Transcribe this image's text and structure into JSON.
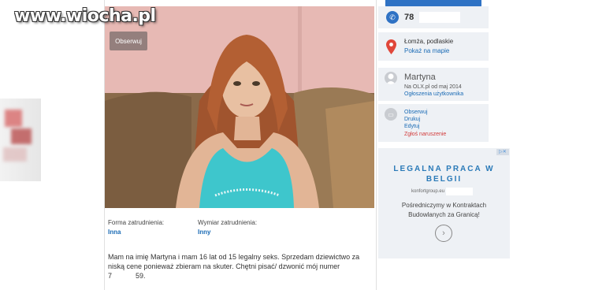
{
  "watermark": {
    "text": "www.wiocha.pl"
  },
  "photo": {
    "observe_label": "Obserwuj"
  },
  "job": {
    "type_label": "Forma zatrudnienia:",
    "type_value": "Inna",
    "dimension_label": "Wymiar zatrudnienia:",
    "dimension_value": "Inny"
  },
  "description": {
    "line1": "Mam na imię Martyna i mam 16 lat od 15 legalny seks. Sprzedam dziewictwo za",
    "line2": "niską cene ponieważ zbieram na skuter. Chętni pisać/ dzwonić mój numer",
    "line3_start": "7",
    "line3_end": "59."
  },
  "sidebar": {
    "phone": {
      "number_prefix": "78"
    },
    "location": {
      "city": "Łomża, podlaskie",
      "map_link": "Pokaż na mapie"
    },
    "user": {
      "name": "Martyna",
      "since": "Na OLX.pl od maj 2014",
      "ads_link": "Ogłoszenia użytkownika"
    },
    "actions": {
      "observe": "Obserwuj",
      "print": "Drukuj",
      "edit": "Edytuj",
      "report": "Zgłoś naruszenie"
    }
  },
  "ad": {
    "title_line1": "LEGALNA PRACA W",
    "title_line2": "BELGII",
    "domain": "konfortgroup.eu",
    "text_line1": "Pośredniczymy w Kontraktach",
    "text_line2": "Budowlanych za Granicą!",
    "close_glyph": "▷✕",
    "arrow_glyph": "›"
  },
  "colors": {
    "link": "#1a6bb5",
    "accent": "#2f72c4",
    "report": "#d23b3b",
    "panel": "#eef1f5"
  }
}
